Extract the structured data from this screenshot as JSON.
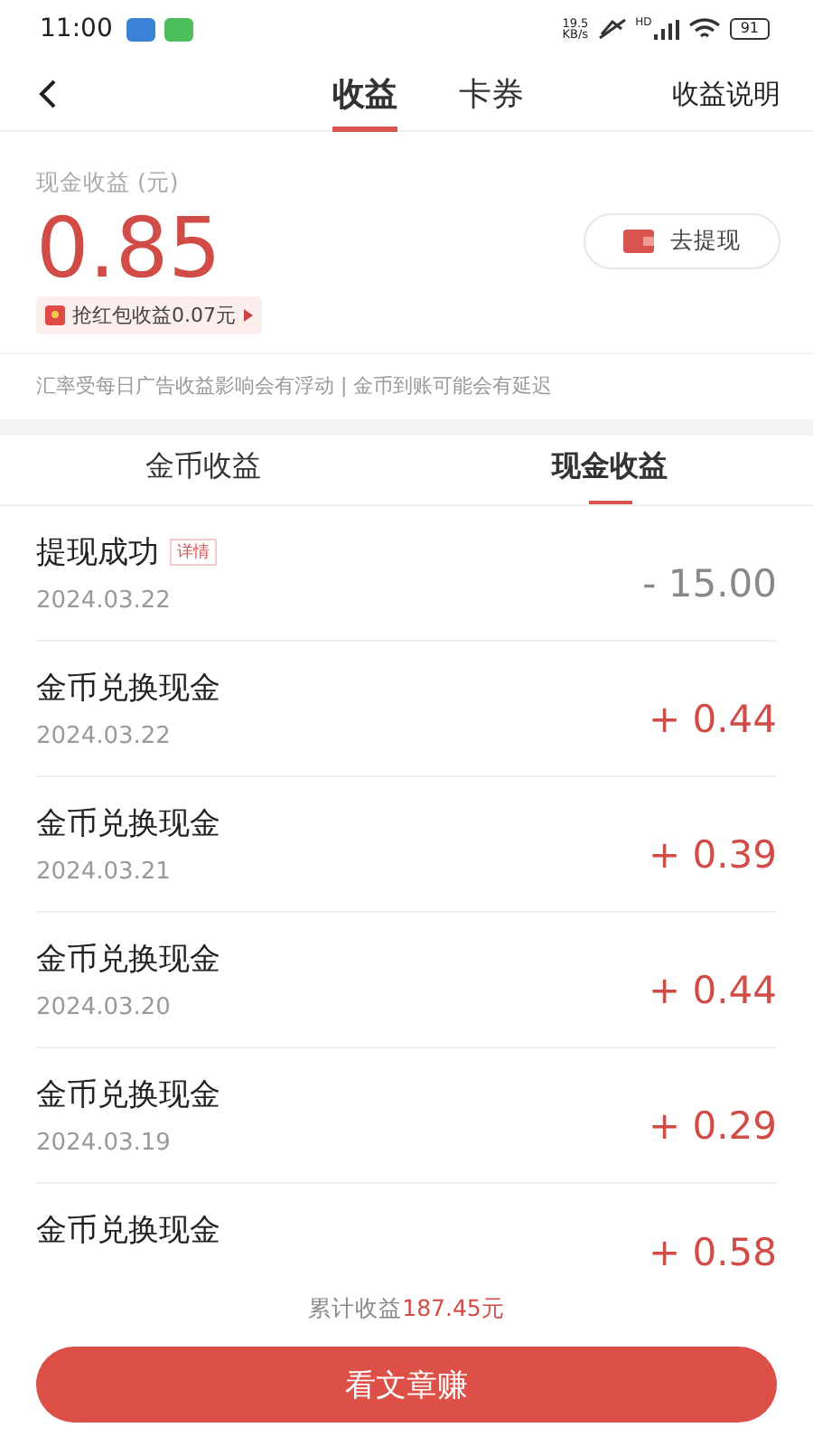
{
  "status_bar": {
    "time": "11:00",
    "speed": "19.5\nKB/s",
    "signal_label": "HD",
    "battery": "91"
  },
  "nav": {
    "tabs": [
      {
        "label": "收益",
        "selected": true
      },
      {
        "label": "卡券",
        "selected": false
      }
    ],
    "action": "收益说明"
  },
  "summary": {
    "label": "现金收益 (元)",
    "amount": "0.85",
    "withdraw_button": "去提现",
    "bonus": "抢红包收益0.07元",
    "notice": "汇率受每日广告收益影响会有浮动 | 金币到账可能会有延迟"
  },
  "list_tabs": [
    {
      "label": "金币收益",
      "selected": false
    },
    {
      "label": "现金收益",
      "selected": true
    }
  ],
  "records": [
    {
      "kind": "withdraw",
      "title": "提现成功",
      "tag": "详情",
      "date": "2024.03.22",
      "amount": "- 15.00"
    },
    {
      "kind": "income",
      "title": "金币兑换现金",
      "date": "2024.03.22",
      "amount": "+ 0.44"
    },
    {
      "kind": "income",
      "title": "金币兑换现金",
      "date": "2024.03.21",
      "amount": "+ 0.39"
    },
    {
      "kind": "income",
      "title": "金币兑换现金",
      "date": "2024.03.20",
      "amount": "+ 0.44"
    },
    {
      "kind": "income",
      "title": "金币兑换现金",
      "date": "2024.03.19",
      "amount": "+ 0.29"
    },
    {
      "kind": "income",
      "title": "金币兑换现金",
      "amount": "+ 0.58"
    }
  ],
  "footer": {
    "total_label": "累计收益",
    "total_value": "187.45元",
    "button": "看文章赚"
  }
}
